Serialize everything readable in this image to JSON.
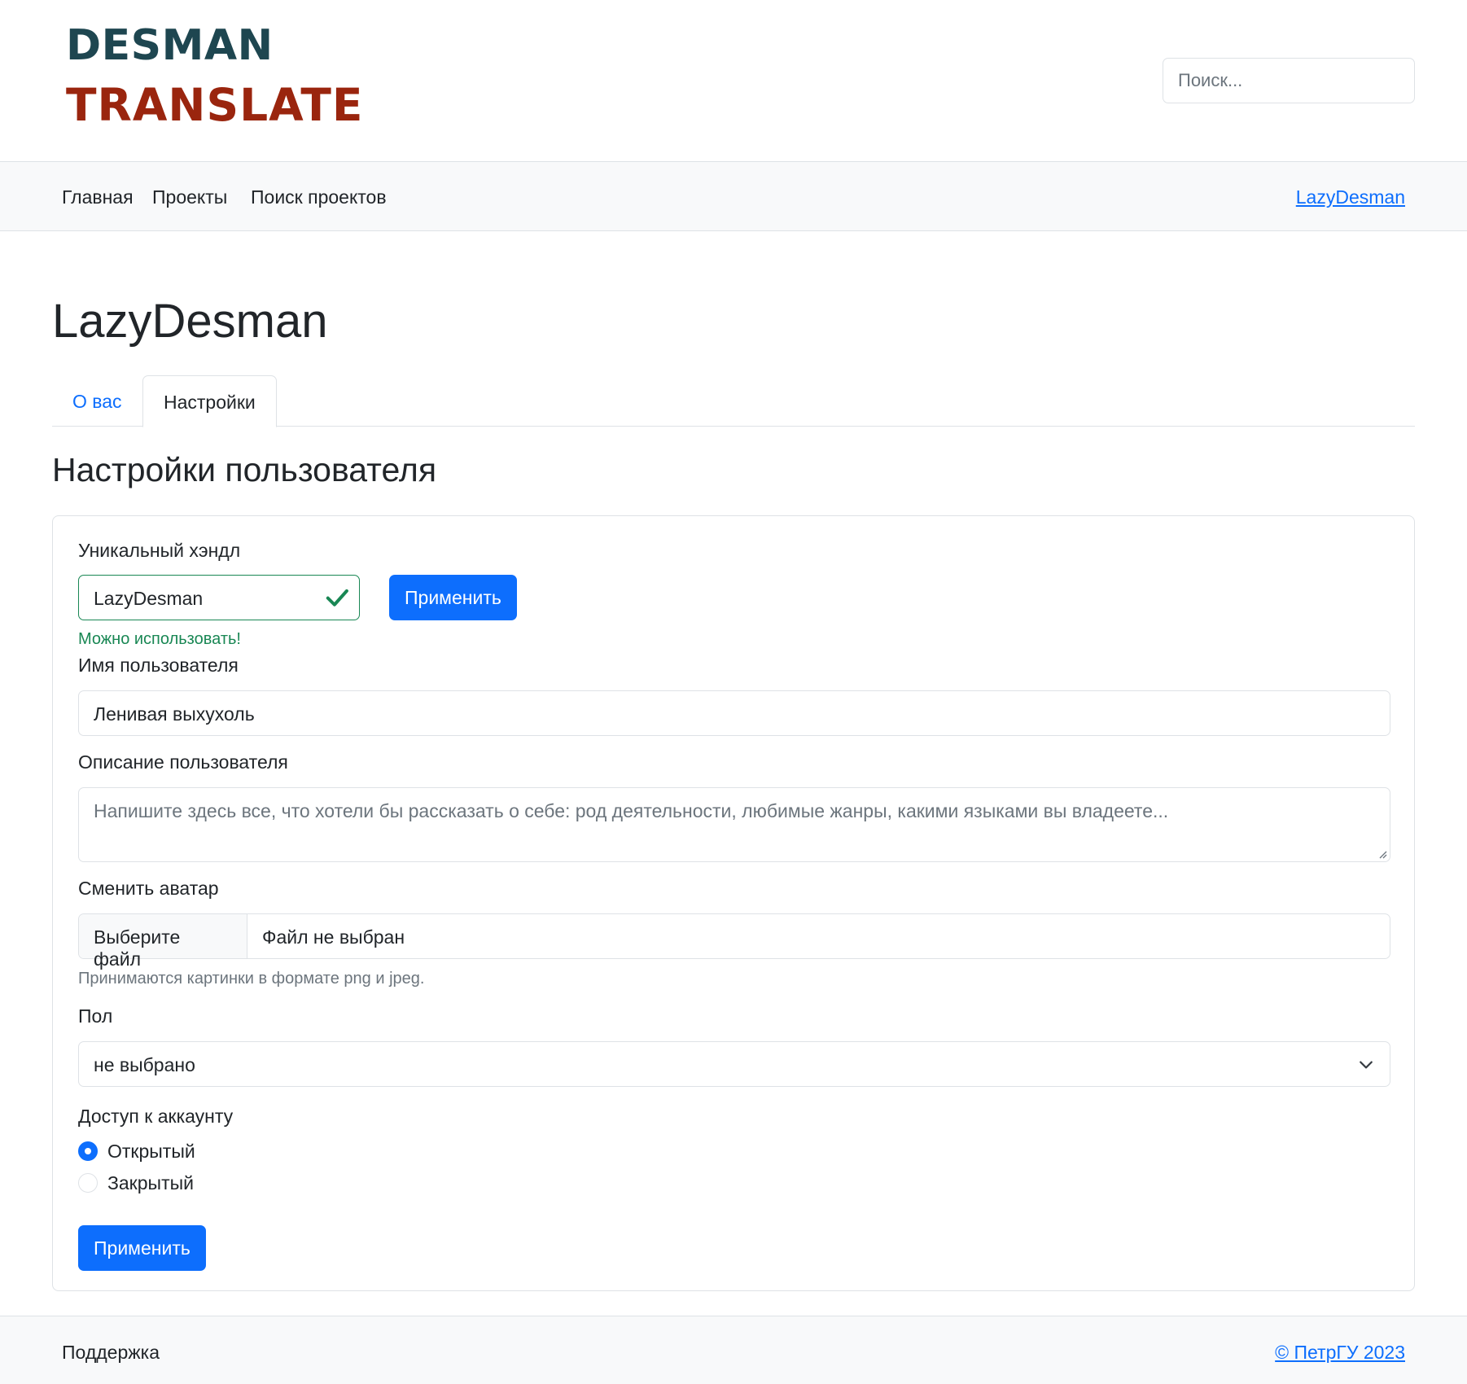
{
  "logo": {
    "line1": "DESMAN",
    "line2": "TRANSLATE",
    "colors": {
      "line1": "#1e4650",
      "line2": "#9a250e"
    }
  },
  "search": {
    "placeholder": "Поиск..."
  },
  "nav": {
    "items": [
      {
        "label": "Главная"
      },
      {
        "label": "Проекты"
      },
      {
        "label": "Поиск проектов"
      }
    ],
    "user_link": "LazyDesman"
  },
  "page": {
    "title": "LazyDesman",
    "tabs": [
      {
        "label": "О вас",
        "active": false
      },
      {
        "label": "Настройки",
        "active": true
      }
    ],
    "section_title": "Настройки пользователя"
  },
  "form": {
    "handle": {
      "label": "Уникальный хэндл",
      "value": "LazyDesman",
      "apply_label": "Применить",
      "valid_message": "Можно использовать!"
    },
    "username": {
      "label": "Имя пользователя",
      "value": "Ленивая выхухоль"
    },
    "description": {
      "label": "Описание пользователя",
      "placeholder": "Напишите здесь все, что хотели бы рассказать о себе: род деятельности, любимые жанры, какими языками вы владеете..."
    },
    "avatar": {
      "label": "Сменить аватар",
      "button_label": "Выберите файл",
      "file_status": "Файл не выбран",
      "hint": "Принимаются картинки в формате png и jpeg."
    },
    "gender": {
      "label": "Пол",
      "selected": "не выбрано"
    },
    "access": {
      "label": "Доступ к аккаунту",
      "options": [
        {
          "label": "Открытый",
          "checked": true
        },
        {
          "label": "Закрытый",
          "checked": false
        }
      ]
    },
    "submit_label": "Применить"
  },
  "footer": {
    "support": "Поддержка",
    "copyright": "© ПетрГУ 2023"
  },
  "colors": {
    "primary": "#0d6efd",
    "success": "#198754",
    "muted": "#6c757d"
  }
}
